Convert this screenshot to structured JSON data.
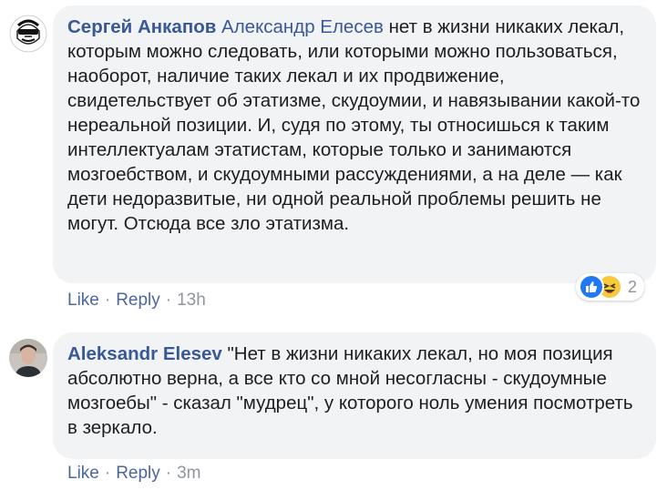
{
  "comments": [
    {
      "author": "Сергей Анкапов",
      "mention": "Александр Елесев",
      "text": " нет в жизни никаких лекал, которым можно следовать, или которыми можно пользоваться, наоборот, наличие таких лекал и их продвижение, свидетельствует об этатизме, скудоумии, и навязывании какой-то нереальной позиции. И, судя по этому, ты относишься к таким интеллектуалам этатистам, которые только и занимаются мозгоебством, и скудоумными рассуждениями, а на деле — как дети недоразвитые, ни одной реальной проблемы решить не могут. Отсюда все зло этатизма.",
      "like_label": "Like",
      "reply_label": "Reply",
      "time": "13h",
      "reactions": {
        "icons": [
          "like-icon",
          "haha-icon"
        ],
        "count": "2"
      }
    },
    {
      "author": "Aleksandr Elesev",
      "text": " \"Нет в жизни никаких лекал, но моя позиция абсолютно верна, а все кто со мной несогласны - скудоумные мозгоебы\" - сказал \"мудрец\", у которого ноль умения посмотреть в зеркало.",
      "like_label": "Like",
      "reply_label": "Reply",
      "time": "3m"
    }
  ],
  "separator": "·",
  "colors": {
    "link": "#385898",
    "bubble": "#f2f3f5",
    "meta": "#90949c",
    "like_blue": "#2078f4",
    "haha_yellow": "#f7c93b"
  }
}
